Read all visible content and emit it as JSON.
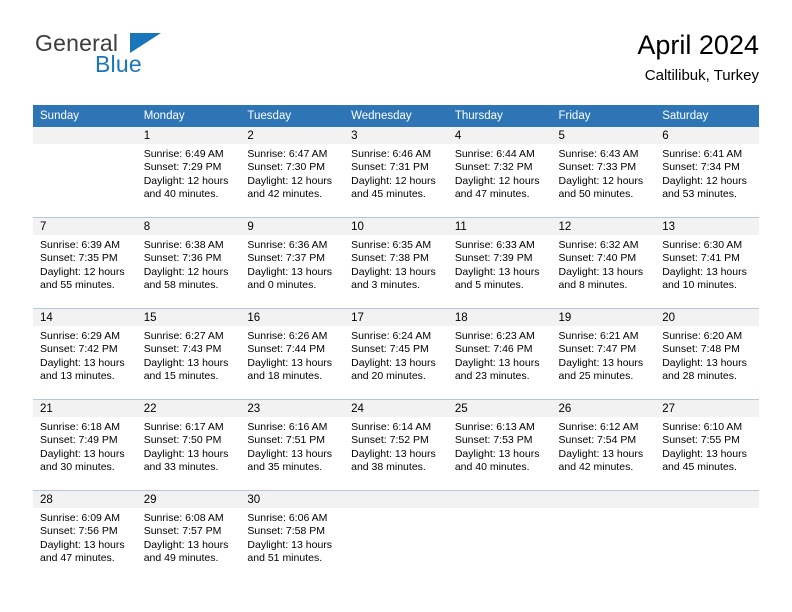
{
  "logo": {
    "word_one": "General",
    "word_two": "Blue",
    "accent_color": "#1b75bb"
  },
  "header": {
    "title": "April 2024",
    "subtitle": "Caltilibuk, Turkey"
  },
  "theme": {
    "header_row_bg": "#2e75b6",
    "daynum_bg": "#f2f2f2",
    "grid_line": "#b9c8d8"
  },
  "weekday_headers": [
    "Sunday",
    "Monday",
    "Tuesday",
    "Wednesday",
    "Thursday",
    "Friday",
    "Saturday"
  ],
  "weeks": [
    {
      "days": [
        {
          "day": "",
          "sunrise": "",
          "sunset": "",
          "daylight_line1": "",
          "daylight_line2": ""
        },
        {
          "day": "1",
          "sunrise": "Sunrise: 6:49 AM",
          "sunset": "Sunset: 7:29 PM",
          "daylight_line1": "Daylight: 12 hours",
          "daylight_line2": "and 40 minutes."
        },
        {
          "day": "2",
          "sunrise": "Sunrise: 6:47 AM",
          "sunset": "Sunset: 7:30 PM",
          "daylight_line1": "Daylight: 12 hours",
          "daylight_line2": "and 42 minutes."
        },
        {
          "day": "3",
          "sunrise": "Sunrise: 6:46 AM",
          "sunset": "Sunset: 7:31 PM",
          "daylight_line1": "Daylight: 12 hours",
          "daylight_line2": "and 45 minutes."
        },
        {
          "day": "4",
          "sunrise": "Sunrise: 6:44 AM",
          "sunset": "Sunset: 7:32 PM",
          "daylight_line1": "Daylight: 12 hours",
          "daylight_line2": "and 47 minutes."
        },
        {
          "day": "5",
          "sunrise": "Sunrise: 6:43 AM",
          "sunset": "Sunset: 7:33 PM",
          "daylight_line1": "Daylight: 12 hours",
          "daylight_line2": "and 50 minutes."
        },
        {
          "day": "6",
          "sunrise": "Sunrise: 6:41 AM",
          "sunset": "Sunset: 7:34 PM",
          "daylight_line1": "Daylight: 12 hours",
          "daylight_line2": "and 53 minutes."
        }
      ]
    },
    {
      "days": [
        {
          "day": "7",
          "sunrise": "Sunrise: 6:39 AM",
          "sunset": "Sunset: 7:35 PM",
          "daylight_line1": "Daylight: 12 hours",
          "daylight_line2": "and 55 minutes."
        },
        {
          "day": "8",
          "sunrise": "Sunrise: 6:38 AM",
          "sunset": "Sunset: 7:36 PM",
          "daylight_line1": "Daylight: 12 hours",
          "daylight_line2": "and 58 minutes."
        },
        {
          "day": "9",
          "sunrise": "Sunrise: 6:36 AM",
          "sunset": "Sunset: 7:37 PM",
          "daylight_line1": "Daylight: 13 hours",
          "daylight_line2": "and 0 minutes."
        },
        {
          "day": "10",
          "sunrise": "Sunrise: 6:35 AM",
          "sunset": "Sunset: 7:38 PM",
          "daylight_line1": "Daylight: 13 hours",
          "daylight_line2": "and 3 minutes."
        },
        {
          "day": "11",
          "sunrise": "Sunrise: 6:33 AM",
          "sunset": "Sunset: 7:39 PM",
          "daylight_line1": "Daylight: 13 hours",
          "daylight_line2": "and 5 minutes."
        },
        {
          "day": "12",
          "sunrise": "Sunrise: 6:32 AM",
          "sunset": "Sunset: 7:40 PM",
          "daylight_line1": "Daylight: 13 hours",
          "daylight_line2": "and 8 minutes."
        },
        {
          "day": "13",
          "sunrise": "Sunrise: 6:30 AM",
          "sunset": "Sunset: 7:41 PM",
          "daylight_line1": "Daylight: 13 hours",
          "daylight_line2": "and 10 minutes."
        }
      ]
    },
    {
      "days": [
        {
          "day": "14",
          "sunrise": "Sunrise: 6:29 AM",
          "sunset": "Sunset: 7:42 PM",
          "daylight_line1": "Daylight: 13 hours",
          "daylight_line2": "and 13 minutes."
        },
        {
          "day": "15",
          "sunrise": "Sunrise: 6:27 AM",
          "sunset": "Sunset: 7:43 PM",
          "daylight_line1": "Daylight: 13 hours",
          "daylight_line2": "and 15 minutes."
        },
        {
          "day": "16",
          "sunrise": "Sunrise: 6:26 AM",
          "sunset": "Sunset: 7:44 PM",
          "daylight_line1": "Daylight: 13 hours",
          "daylight_line2": "and 18 minutes."
        },
        {
          "day": "17",
          "sunrise": "Sunrise: 6:24 AM",
          "sunset": "Sunset: 7:45 PM",
          "daylight_line1": "Daylight: 13 hours",
          "daylight_line2": "and 20 minutes."
        },
        {
          "day": "18",
          "sunrise": "Sunrise: 6:23 AM",
          "sunset": "Sunset: 7:46 PM",
          "daylight_line1": "Daylight: 13 hours",
          "daylight_line2": "and 23 minutes."
        },
        {
          "day": "19",
          "sunrise": "Sunrise: 6:21 AM",
          "sunset": "Sunset: 7:47 PM",
          "daylight_line1": "Daylight: 13 hours",
          "daylight_line2": "and 25 minutes."
        },
        {
          "day": "20",
          "sunrise": "Sunrise: 6:20 AM",
          "sunset": "Sunset: 7:48 PM",
          "daylight_line1": "Daylight: 13 hours",
          "daylight_line2": "and 28 minutes."
        }
      ]
    },
    {
      "days": [
        {
          "day": "21",
          "sunrise": "Sunrise: 6:18 AM",
          "sunset": "Sunset: 7:49 PM",
          "daylight_line1": "Daylight: 13 hours",
          "daylight_line2": "and 30 minutes."
        },
        {
          "day": "22",
          "sunrise": "Sunrise: 6:17 AM",
          "sunset": "Sunset: 7:50 PM",
          "daylight_line1": "Daylight: 13 hours",
          "daylight_line2": "and 33 minutes."
        },
        {
          "day": "23",
          "sunrise": "Sunrise: 6:16 AM",
          "sunset": "Sunset: 7:51 PM",
          "daylight_line1": "Daylight: 13 hours",
          "daylight_line2": "and 35 minutes."
        },
        {
          "day": "24",
          "sunrise": "Sunrise: 6:14 AM",
          "sunset": "Sunset: 7:52 PM",
          "daylight_line1": "Daylight: 13 hours",
          "daylight_line2": "and 38 minutes."
        },
        {
          "day": "25",
          "sunrise": "Sunrise: 6:13 AM",
          "sunset": "Sunset: 7:53 PM",
          "daylight_line1": "Daylight: 13 hours",
          "daylight_line2": "and 40 minutes."
        },
        {
          "day": "26",
          "sunrise": "Sunrise: 6:12 AM",
          "sunset": "Sunset: 7:54 PM",
          "daylight_line1": "Daylight: 13 hours",
          "daylight_line2": "and 42 minutes."
        },
        {
          "day": "27",
          "sunrise": "Sunrise: 6:10 AM",
          "sunset": "Sunset: 7:55 PM",
          "daylight_line1": "Daylight: 13 hours",
          "daylight_line2": "and 45 minutes."
        }
      ]
    },
    {
      "days": [
        {
          "day": "28",
          "sunrise": "Sunrise: 6:09 AM",
          "sunset": "Sunset: 7:56 PM",
          "daylight_line1": "Daylight: 13 hours",
          "daylight_line2": "and 47 minutes."
        },
        {
          "day": "29",
          "sunrise": "Sunrise: 6:08 AM",
          "sunset": "Sunset: 7:57 PM",
          "daylight_line1": "Daylight: 13 hours",
          "daylight_line2": "and 49 minutes."
        },
        {
          "day": "30",
          "sunrise": "Sunrise: 6:06 AM",
          "sunset": "Sunset: 7:58 PM",
          "daylight_line1": "Daylight: 13 hours",
          "daylight_line2": "and 51 minutes."
        },
        {
          "day": "",
          "sunrise": "",
          "sunset": "",
          "daylight_line1": "",
          "daylight_line2": ""
        },
        {
          "day": "",
          "sunrise": "",
          "sunset": "",
          "daylight_line1": "",
          "daylight_line2": ""
        },
        {
          "day": "",
          "sunrise": "",
          "sunset": "",
          "daylight_line1": "",
          "daylight_line2": ""
        },
        {
          "day": "",
          "sunrise": "",
          "sunset": "",
          "daylight_line1": "",
          "daylight_line2": ""
        }
      ]
    }
  ]
}
